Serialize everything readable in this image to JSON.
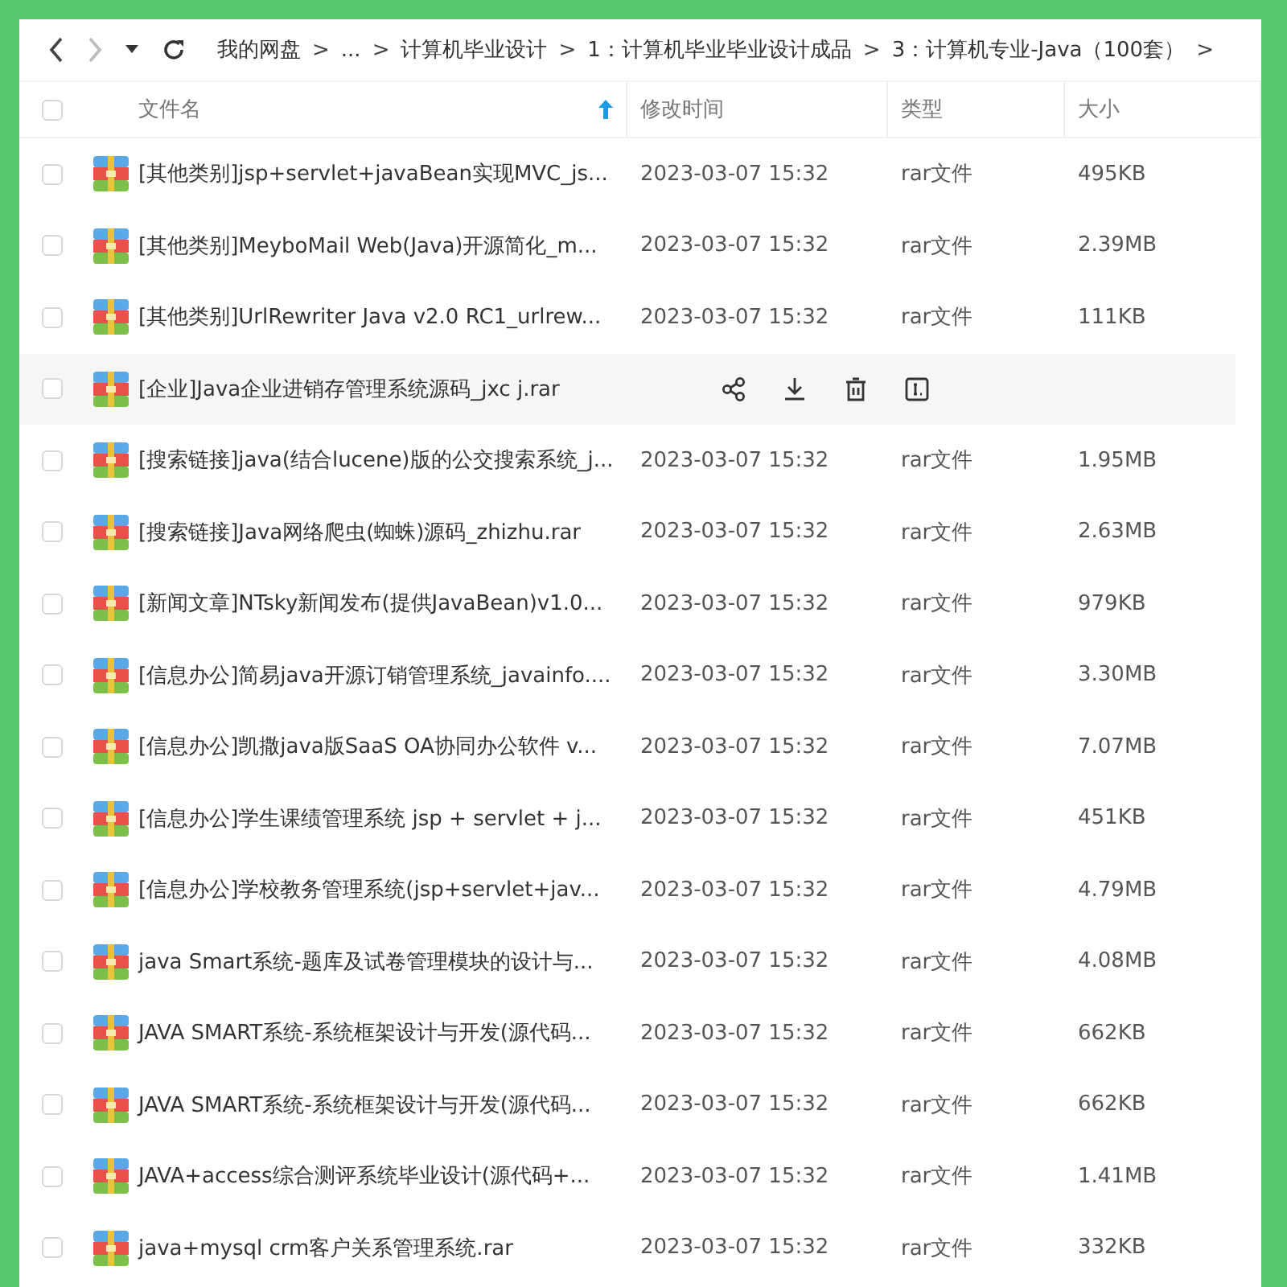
{
  "nav": {
    "breadcrumbs": [
      "我的网盘",
      "...",
      "计算机毕业设计",
      "1：计算机毕业毕业设计成品",
      "3：计算机专业-Java（100套）"
    ],
    "separator": ">"
  },
  "table": {
    "select_all": {
      "checked": false
    },
    "columns": [
      {
        "label": "文件名",
        "sorted": true
      },
      {
        "label": "修改时间",
        "sorted": false
      },
      {
        "label": "类型",
        "sorted": false
      },
      {
        "label": "大小",
        "sorted": false
      }
    ],
    "rows": [
      {
        "name": "[其他类别]jsp+servlet+javaBean实现MVC_js...",
        "modified": "2023-03-07 15:32",
        "type": "rar文件",
        "size": "495KB",
        "checked": false,
        "hovered": false
      },
      {
        "name": "[其他类别]MeyboMail Web(Java)开源简化_m...",
        "modified": "2023-03-07 15:32",
        "type": "rar文件",
        "size": "2.39MB",
        "checked": false,
        "hovered": false
      },
      {
        "name": "[其他类别]UrlRewriter Java v2.0 RC1_urlrew...",
        "modified": "2023-03-07 15:32",
        "type": "rar文件",
        "size": "111KB",
        "checked": false,
        "hovered": false
      },
      {
        "name": "[企业]Java企业进销存管理系统源码_jxc j.rar",
        "checked": false,
        "hovered": true
      },
      {
        "name": "[搜索链接]java(结合lucene)版的公交搜索系统_j...",
        "modified": "2023-03-07 15:32",
        "type": "rar文件",
        "size": "1.95MB",
        "checked": false,
        "hovered": false
      },
      {
        "name": "[搜索链接]Java网络爬虫(蜘蛛)源码_zhizhu.rar",
        "modified": "2023-03-07 15:32",
        "type": "rar文件",
        "size": "2.63MB",
        "checked": false,
        "hovered": false
      },
      {
        "name": "[新闻文章]NTsky新闻发布(提供JavaBean)v1.0...",
        "modified": "2023-03-07 15:32",
        "type": "rar文件",
        "size": "979KB",
        "checked": false,
        "hovered": false
      },
      {
        "name": "[信息办公]简易java开源订销管理系统_javainfo....",
        "modified": "2023-03-07 15:32",
        "type": "rar文件",
        "size": "3.30MB",
        "checked": false,
        "hovered": false
      },
      {
        "name": "[信息办公]凯撒java版SaaS OA协同办公软件 v...",
        "modified": "2023-03-07 15:32",
        "type": "rar文件",
        "size": "7.07MB",
        "checked": false,
        "hovered": false
      },
      {
        "name": "[信息办公]学生课绩管理系统 jsp + servlet + j...",
        "modified": "2023-03-07 15:32",
        "type": "rar文件",
        "size": "451KB",
        "checked": false,
        "hovered": false
      },
      {
        "name": "[信息办公]学校教务管理系统(jsp+servlet+jav...",
        "modified": "2023-03-07 15:32",
        "type": "rar文件",
        "size": "4.79MB",
        "checked": false,
        "hovered": false
      },
      {
        "name": "java Smart系统-题库及试卷管理模块的设计与...",
        "modified": "2023-03-07 15:32",
        "type": "rar文件",
        "size": "4.08MB",
        "checked": false,
        "hovered": false
      },
      {
        "name": "JAVA SMART系统-系统框架设计与开发(源代码...",
        "modified": "2023-03-07 15:32",
        "type": "rar文件",
        "size": "662KB",
        "checked": false,
        "hovered": false
      },
      {
        "name": "JAVA SMART系统-系统框架设计与开发(源代码...",
        "modified": "2023-03-07 15:32",
        "type": "rar文件",
        "size": "662KB",
        "checked": false,
        "hovered": false
      },
      {
        "name": "JAVA+access综合测评系统毕业设计(源代码+...",
        "modified": "2023-03-07 15:32",
        "type": "rar文件",
        "size": "1.41MB",
        "checked": false,
        "hovered": false
      },
      {
        "name": "java+mysql crm客户关系管理系统.rar",
        "modified": "2023-03-07 15:32",
        "type": "rar文件",
        "size": "332KB",
        "checked": false,
        "hovered": false
      }
    ]
  }
}
